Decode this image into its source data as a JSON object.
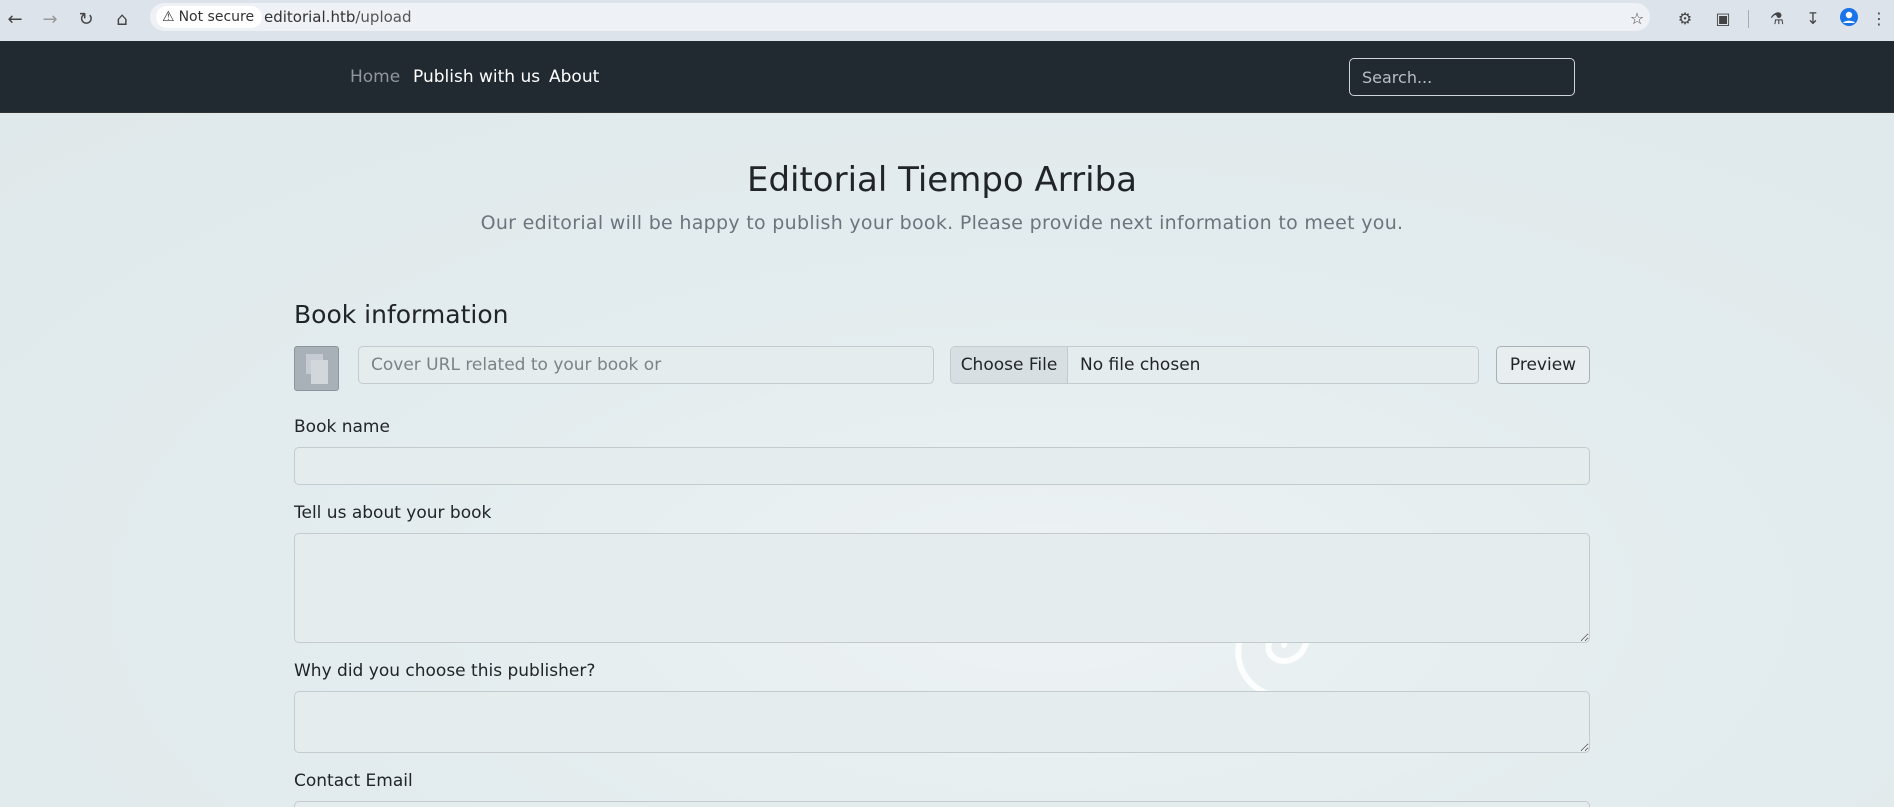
{
  "browser": {
    "security_label": "Not secure",
    "url_host": "editorial.htb",
    "url_path": "/upload"
  },
  "navbar": {
    "links": [
      "Home",
      "Publish with us",
      "About"
    ],
    "search_placeholder": "Search..."
  },
  "hero": {
    "title": "Editorial Tiempo Arriba",
    "subtitle": "Our editorial will be happy to publish your book. Please provide next information to meet you."
  },
  "form": {
    "section_title": "Book information",
    "cover_url_placeholder": "Cover URL related to your book or",
    "file_button_label": "Choose File",
    "file_status": "No file chosen",
    "preview_label": "Preview",
    "book_name_label": "Book name",
    "book_name_value": "",
    "about_label": "Tell us about your book",
    "why_label": "Why did you choose this publisher?",
    "email_label": "Contact Email"
  }
}
